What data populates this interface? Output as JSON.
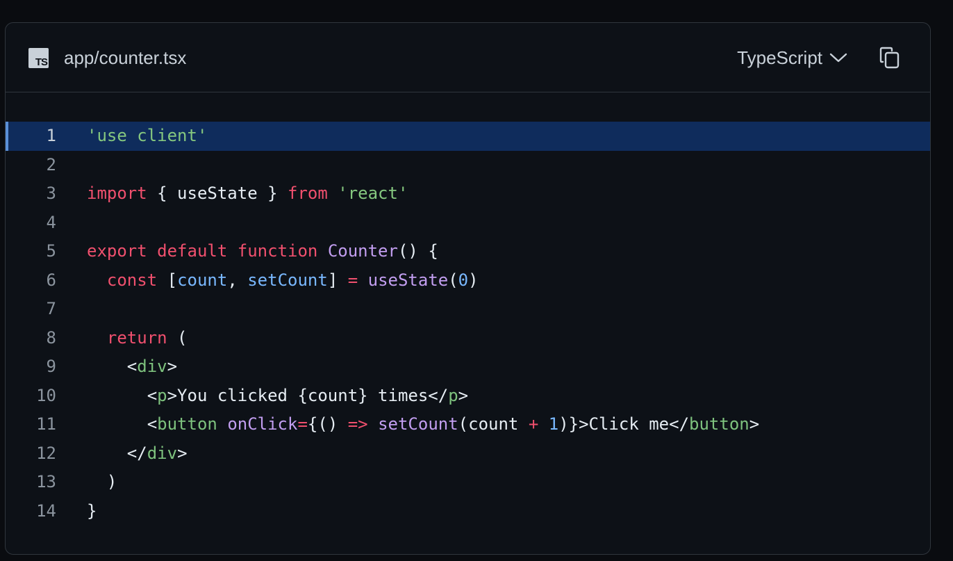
{
  "header": {
    "filename": "app/counter.tsx",
    "file_icon_label": "TS",
    "language": "TypeScript",
    "icons": {
      "file": "typescript-file-icon",
      "dropdown": "chevron-down-icon",
      "copy": "copy-icon"
    }
  },
  "colors": {
    "background": "#0d1117",
    "highlight": "#0f2c5c",
    "keyword": "#f0506e",
    "string": "#85c77f",
    "function": "#c29ef0",
    "variable": "#79b8ff"
  },
  "code": {
    "active_line": 1,
    "lines": [
      {
        "number": "1",
        "tokens": [
          {
            "t": "'use client'",
            "c": "str"
          }
        ]
      },
      {
        "number": "2",
        "tokens": []
      },
      {
        "number": "3",
        "tokens": [
          {
            "t": "import",
            "c": "kw"
          },
          {
            "t": " { useState } ",
            "c": "punc"
          },
          {
            "t": "from",
            "c": "kw"
          },
          {
            "t": " ",
            "c": "punc"
          },
          {
            "t": "'react'",
            "c": "str"
          }
        ]
      },
      {
        "number": "4",
        "tokens": []
      },
      {
        "number": "5",
        "tokens": [
          {
            "t": "export",
            "c": "kw"
          },
          {
            "t": " ",
            "c": "punc"
          },
          {
            "t": "default",
            "c": "kw"
          },
          {
            "t": " ",
            "c": "punc"
          },
          {
            "t": "function",
            "c": "kw"
          },
          {
            "t": " ",
            "c": "punc"
          },
          {
            "t": "Counter",
            "c": "fn"
          },
          {
            "t": "() {",
            "c": "punc"
          }
        ]
      },
      {
        "number": "6",
        "tokens": [
          {
            "t": "  ",
            "c": "punc"
          },
          {
            "t": "const",
            "c": "kw"
          },
          {
            "t": " [",
            "c": "punc"
          },
          {
            "t": "count",
            "c": "var"
          },
          {
            "t": ", ",
            "c": "punc"
          },
          {
            "t": "setCount",
            "c": "var"
          },
          {
            "t": "] ",
            "c": "punc"
          },
          {
            "t": "=",
            "c": "kw"
          },
          {
            "t": " ",
            "c": "punc"
          },
          {
            "t": "useState",
            "c": "fn"
          },
          {
            "t": "(",
            "c": "punc"
          },
          {
            "t": "0",
            "c": "num"
          },
          {
            "t": ")",
            "c": "punc"
          }
        ]
      },
      {
        "number": "7",
        "tokens": []
      },
      {
        "number": "8",
        "tokens": [
          {
            "t": "  ",
            "c": "punc"
          },
          {
            "t": "return",
            "c": "kw"
          },
          {
            "t": " (",
            "c": "punc"
          }
        ]
      },
      {
        "number": "9",
        "tokens": [
          {
            "t": "    <",
            "c": "punc"
          },
          {
            "t": "div",
            "c": "tag"
          },
          {
            "t": ">",
            "c": "punc"
          }
        ]
      },
      {
        "number": "10",
        "tokens": [
          {
            "t": "      <",
            "c": "punc"
          },
          {
            "t": "p",
            "c": "tag"
          },
          {
            "t": ">You clicked {count} times</",
            "c": "punc"
          },
          {
            "t": "p",
            "c": "tag"
          },
          {
            "t": ">",
            "c": "punc"
          }
        ]
      },
      {
        "number": "11",
        "tokens": [
          {
            "t": "      <",
            "c": "punc"
          },
          {
            "t": "button",
            "c": "tag"
          },
          {
            "t": " ",
            "c": "punc"
          },
          {
            "t": "onClick",
            "c": "attr"
          },
          {
            "t": "=",
            "c": "kw"
          },
          {
            "t": "{() ",
            "c": "punc"
          },
          {
            "t": "=>",
            "c": "kw"
          },
          {
            "t": " ",
            "c": "punc"
          },
          {
            "t": "setCount",
            "c": "fn"
          },
          {
            "t": "(count ",
            "c": "punc"
          },
          {
            "t": "+",
            "c": "kw"
          },
          {
            "t": " ",
            "c": "punc"
          },
          {
            "t": "1",
            "c": "num"
          },
          {
            "t": ")}>Click me</",
            "c": "punc"
          },
          {
            "t": "button",
            "c": "tag"
          },
          {
            "t": ">",
            "c": "punc"
          }
        ]
      },
      {
        "number": "12",
        "tokens": [
          {
            "t": "    </",
            "c": "punc"
          },
          {
            "t": "div",
            "c": "tag"
          },
          {
            "t": ">",
            "c": "punc"
          }
        ]
      },
      {
        "number": "13",
        "tokens": [
          {
            "t": "  )",
            "c": "punc"
          }
        ]
      },
      {
        "number": "14",
        "tokens": [
          {
            "t": "}",
            "c": "punc"
          }
        ]
      }
    ]
  }
}
